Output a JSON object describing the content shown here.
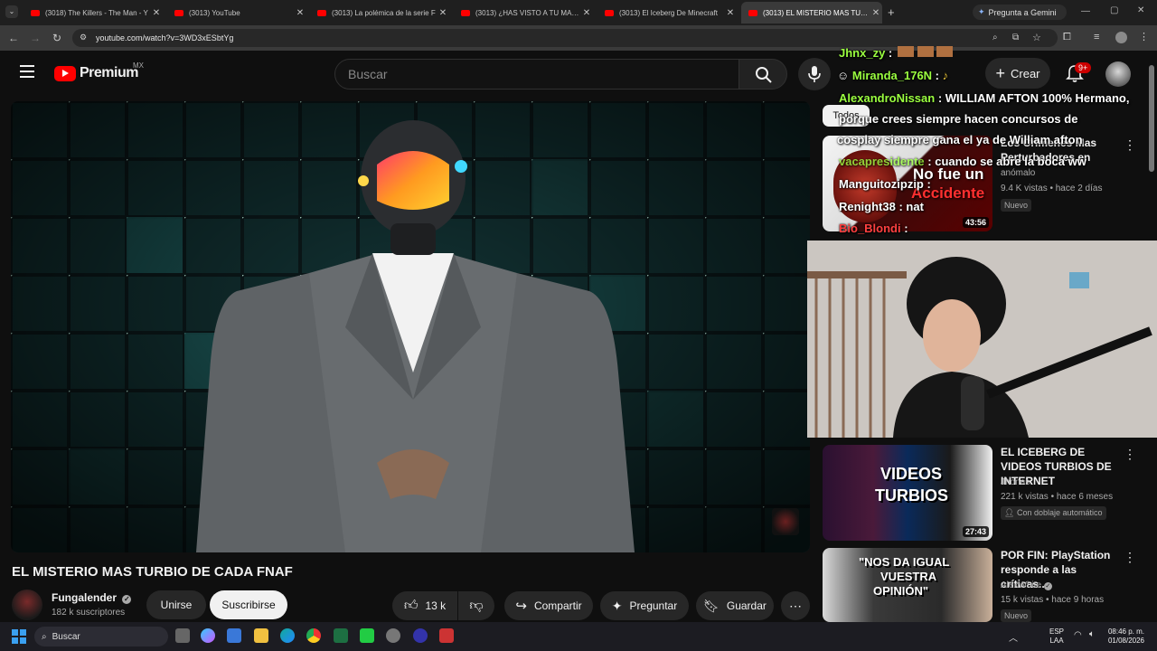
{
  "browser": {
    "tabs": [
      {
        "title": "(3018) The Killers - The Man - Y"
      },
      {
        "title": "(3013) YouTube"
      },
      {
        "title": "(3013) La polémica de la serie F"
      },
      {
        "title": "(3013) ¿HAS VISTO A TU MASC"
      },
      {
        "title": "(3013) El Iceberg De Minecraft"
      },
      {
        "title": "(3013) EL MISTERIO MAS TURB"
      }
    ],
    "new_tab": "+",
    "gemini_label": "Pregunta a Gemini",
    "url": "youtube.com/watch?v=3WD3xESbtYg"
  },
  "masthead": {
    "brand": "Premium",
    "region": "MX",
    "search_placeholder": "Buscar",
    "create_label": "Crear",
    "notif_count": "9+"
  },
  "video": {
    "title": "EL MISTERIO MAS TURBIO DE CADA FNAF"
  },
  "channel": {
    "name": "Fungalender",
    "subs": "182 k suscriptores",
    "join_label": "Unirse",
    "subscribe_label": "Suscribirse"
  },
  "actions": {
    "likes": "13 k",
    "share": "Compartir",
    "ask": "Preguntar",
    "save": "Guardar"
  },
  "chat": [
    {
      "user": "Jhnx_zy",
      "text": ""
    },
    {
      "user": "Miranda_176N",
      "text": ""
    },
    {
      "user": "AlexandroNissan",
      "text": "WILLIAM AFTON 100% Hermano,"
    },
    {
      "user": "",
      "text": "porque crees   siempre   hacen concursos de"
    },
    {
      "user": "",
      "text": "cosplay siempre gana el   ya de William afton"
    },
    {
      "user": "vacapresidente",
      "text": "cuando se abre la boca ww"
    },
    {
      "user": "Manguitozipzip",
      "text": ""
    },
    {
      "user": "Renight38",
      "text": "nat"
    },
    {
      "user": "Bio_Blondi",
      "text": ""
    }
  ],
  "sidebar": {
    "chip": "Todos",
    "recs": [
      {
        "title": "Los Crimenes Mas Perturbadores en",
        "channel": "anómalo",
        "meta": "9.4 K vistas • hace 2 días",
        "badge": "Nuevo",
        "duration": "43:56",
        "thumb_text_1": "No fue un",
        "thumb_text_2": "Accidente"
      },
      {
        "title": "EL ICEBERG DE VIDEOS TURBIOS DE INTERNET",
        "channel": "Jhonas",
        "meta": "221 k vistas • hace 6 meses",
        "badge": "Con doblaje automático",
        "duration": "27:43",
        "thumb_text_1": "VIDEOS",
        "thumb_text_2": "TURBIOS"
      },
      {
        "title": "POR FIN: PlayStation responde a las críticas...",
        "channel": "AlexWhite",
        "meta": "15 k vistas • hace 9 horas",
        "badge": "Nuevo",
        "duration": "",
        "thumb_text_1": "\"NOS DA IGUAL",
        "thumb_text_2": "VUESTRA",
        "thumb_text_3": "OPINIÓN\""
      }
    ]
  },
  "taskbar": {
    "search_label": "Buscar",
    "lang_1": "ESP",
    "lang_2": "LAA",
    "time": "08:46 p. m.",
    "date": "01/08/2026"
  }
}
